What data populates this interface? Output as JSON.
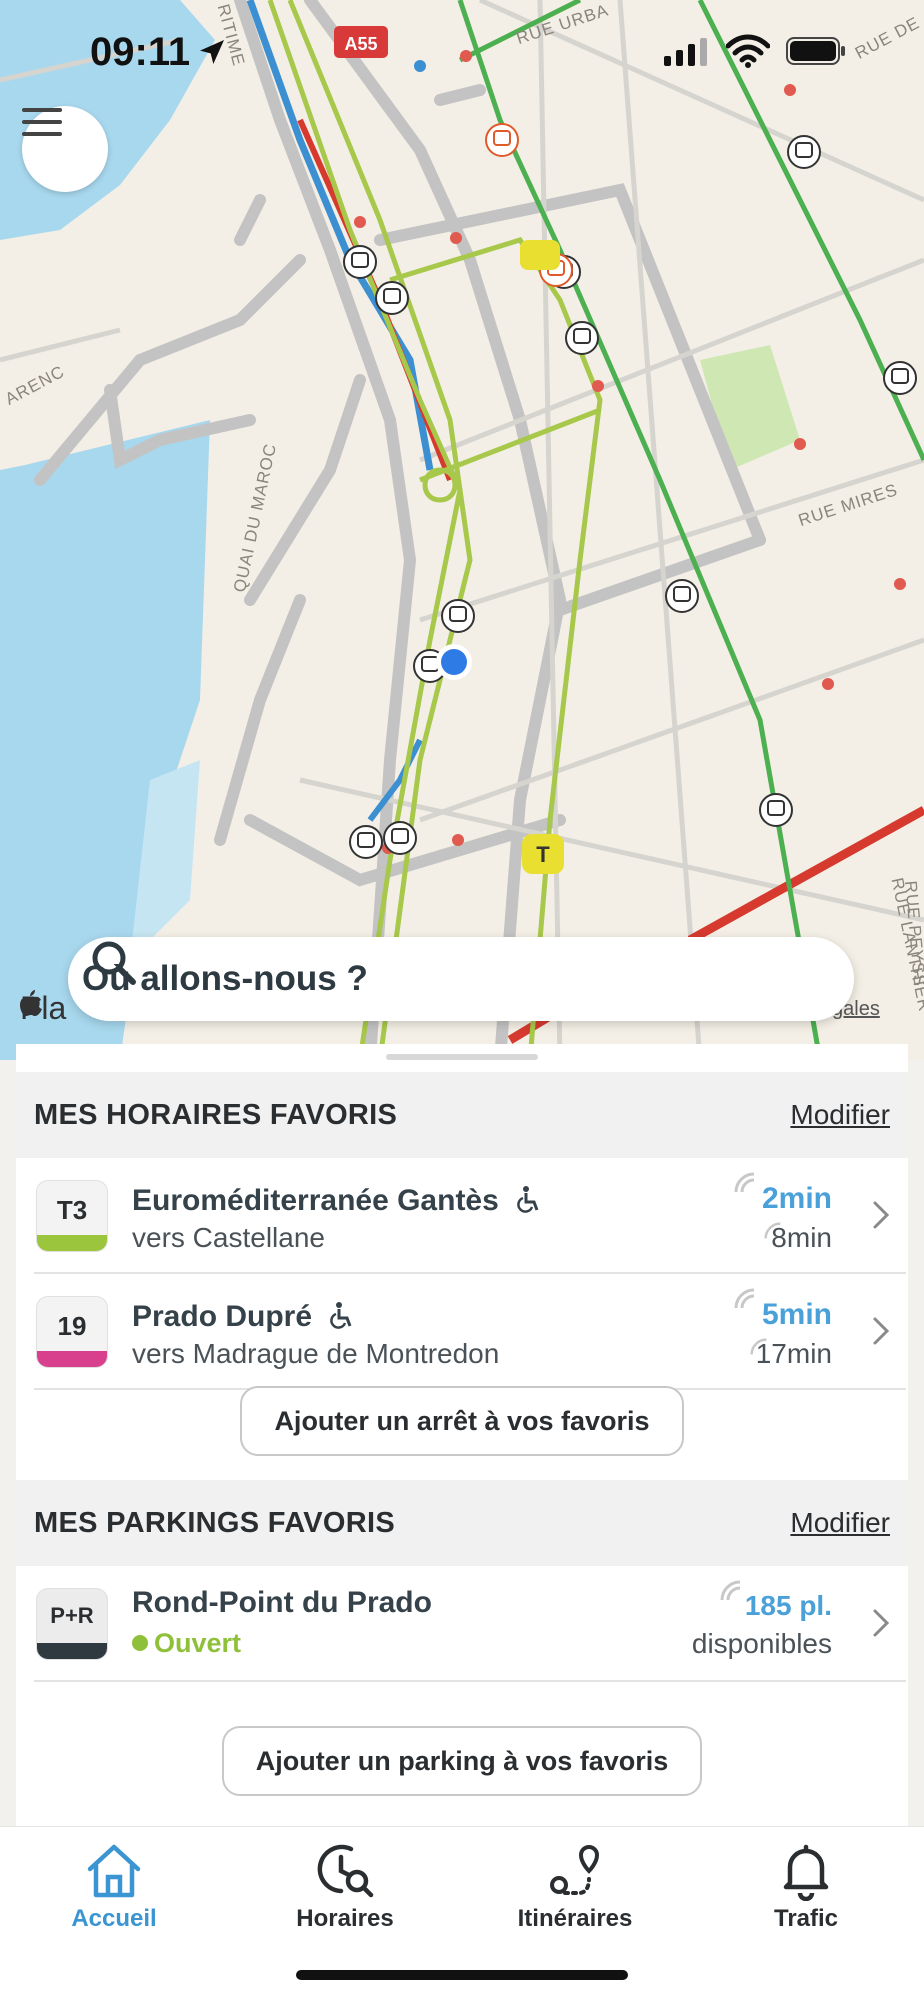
{
  "status_bar": {
    "time": "09:11"
  },
  "map": {
    "labels": {
      "quai_du_maroc": "QUAI DU MAROC",
      "rue_mires": "RUE MIRES",
      "arenc": "ARENC",
      "rue_lanthier": "RUE LANTHIER",
      "rue_peyss": "RUE PEYSS",
      "ritime": "RITIME",
      "rue_urba": "RUE URBA",
      "rue_de": "RUE DE",
      "highway": "A55",
      "maps_credit": "Pla",
      "legal_credit": "gales"
    },
    "search": {
      "placeholder": "Où allons-nous ?"
    },
    "colors": {
      "water": "#a8d8ee",
      "metro_blue": "#3c8fd0",
      "tram_green": "#a7c84a",
      "metro_red": "#d63a2e",
      "green_line": "#4caf50",
      "road_grey": "#b8b8b8"
    }
  },
  "favorites": {
    "schedules": {
      "title": "MES HORAIRES FAVORIS",
      "modify_label": "Modifier",
      "items": [
        {
          "line": "T3",
          "line_color": "#9bc53d",
          "stop": "Euroméditerranée Gantès",
          "direction": "vers Castellane",
          "next": "2min",
          "following": "8min"
        },
        {
          "line": "19",
          "line_color": "#d83f8d",
          "stop": "Prado Dupré",
          "direction": "vers Madrague de Montredon",
          "next": "5min",
          "following": "17min"
        }
      ],
      "add_label": "Ajouter un arrêt à vos favoris"
    },
    "parkings": {
      "title": "MES PARKINGS FAVORIS",
      "modify_label": "Modifier",
      "items": [
        {
          "name": "Rond-Point du Prado",
          "badge": "P+R",
          "status": "Ouvert",
          "places": "185 pl.",
          "places_label": "disponibles"
        }
      ],
      "add_label": "Ajouter un parking à vos favoris"
    }
  },
  "tabs": [
    {
      "label": "Accueil",
      "icon": "home-icon",
      "active": true
    },
    {
      "label": "Horaires",
      "icon": "clock-search-icon",
      "active": false
    },
    {
      "label": "Itinéraires",
      "icon": "route-icon",
      "active": false
    },
    {
      "label": "Trafic",
      "icon": "bell-icon",
      "active": false
    }
  ],
  "accent_color": "#3a95d2"
}
